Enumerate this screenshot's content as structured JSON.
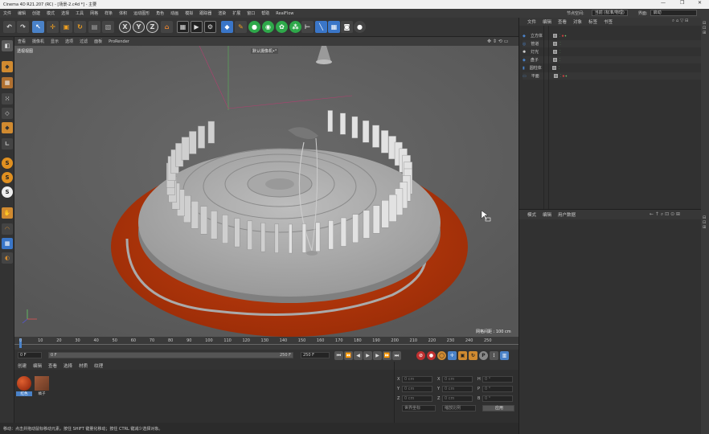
{
  "window": {
    "title": "Cinema 4D R21.207 (RC) - [场景-2.c4d *] - 主要",
    "controls": [
      "—",
      "❐",
      "✕"
    ]
  },
  "menu": {
    "items": [
      "文件",
      "编辑",
      "创建",
      "模式",
      "选择",
      "工具",
      "网格",
      "样条",
      "体积",
      "运动图形",
      "角色",
      "动画",
      "模拟",
      "跟踪器",
      "渲染",
      "扩展",
      "窗口",
      "帮助",
      "RealFlow"
    ],
    "node_space_label": "节点空间:",
    "node_space_value": "当前 (标准/物理)",
    "layout_label": "界面:",
    "layout_value": "启动"
  },
  "toolbar": {
    "axis_x": "X",
    "axis_y": "Y",
    "axis_z": "Z"
  },
  "viewport": {
    "menu": [
      "查看",
      "摄像机",
      "显示",
      "选项",
      "过滤",
      "面板",
      "ProRender"
    ],
    "view_name": "透视视图",
    "camera_label": "默认摄像机•°",
    "grid_spacing": "网格间距 : 100 cm"
  },
  "timeline": {
    "ticks": [
      "0",
      "10",
      "20",
      "30",
      "40",
      "50",
      "60",
      "70",
      "80",
      "90",
      "100",
      "110",
      "120",
      "130",
      "140",
      "150",
      "160",
      "170",
      "180",
      "190",
      "200",
      "210",
      "220",
      "230",
      "240",
      "250"
    ],
    "current_frame": "0 F"
  },
  "transport": {
    "start": "0 F",
    "range_start": "0 F",
    "range_end": "250 F",
    "end": "250 F"
  },
  "materials": {
    "menu": [
      "创建",
      "编辑",
      "查看",
      "选择",
      "材质",
      "纹理"
    ],
    "items": [
      {
        "name": "红色",
        "color": "#b8380c"
      },
      {
        "name": "橘子",
        "color": "#8a4a2a"
      }
    ]
  },
  "coords": {
    "fields": [
      {
        "axis": "X",
        "value": "0 cm"
      },
      {
        "axis": "X",
        "value": "0 cm"
      },
      {
        "axis": "H",
        "value": "0 °"
      },
      {
        "axis": "Y",
        "value": "0 cm"
      },
      {
        "axis": "Y",
        "value": "0 cm"
      },
      {
        "axis": "P",
        "value": "0 °"
      },
      {
        "axis": "Z",
        "value": "0 cm"
      },
      {
        "axis": "Z",
        "value": "0 cm"
      },
      {
        "axis": "B",
        "value": "0 °"
      }
    ],
    "mode_world": "世界坐标",
    "mode_scale": "缩放比例",
    "apply": "应用"
  },
  "object_manager": {
    "menu": [
      "文件",
      "编辑",
      "查看",
      "对象",
      "标签",
      "书签"
    ],
    "objects": [
      {
        "name": "立方体",
        "tag_color": "#d04040"
      },
      {
        "name": "管道",
        "tag_color": ""
      },
      {
        "name": "灯光",
        "tag_color": ""
      },
      {
        "name": "盘子",
        "tag_color": ""
      },
      {
        "name": "圆柱体",
        "tag_color": ""
      },
      {
        "name": "平面",
        "tag_color": "#d04040"
      }
    ]
  },
  "attr_manager": {
    "menu": [
      "模式",
      "编辑",
      "用户数据"
    ]
  },
  "status": {
    "text": "移动：点击并拖动鼠标移动元素。按住 SHIFT 键量化移动；按住 CTRL 键减少选择对象。"
  },
  "colors": {
    "accent": "#4a82c8",
    "floor": "#b8380c"
  }
}
